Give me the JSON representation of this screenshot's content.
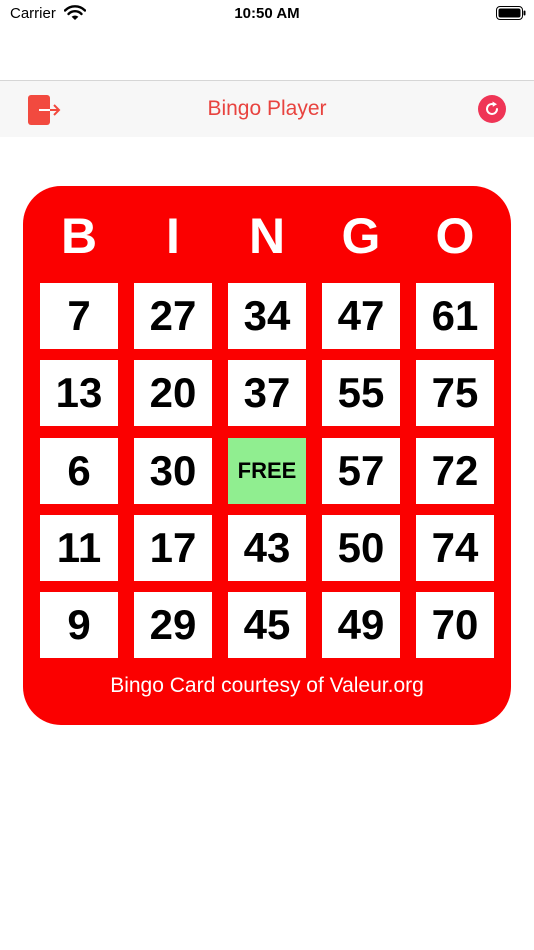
{
  "status_bar": {
    "carrier": "Carrier",
    "time": "10:50 AM",
    "icons": [
      "wifi-icon",
      "battery-icon"
    ]
  },
  "nav": {
    "title": "Bingo Player",
    "left_icon": "exit-icon",
    "right_icon": "refresh-icon",
    "accent_color": "#e8433f"
  },
  "card": {
    "background_color": "#fb0000",
    "free_color": "#90ee90",
    "letters": [
      "B",
      "I",
      "N",
      "G",
      "O"
    ],
    "rows": [
      [
        "7",
        "27",
        "34",
        "47",
        "61"
      ],
      [
        "13",
        "20",
        "37",
        "55",
        "75"
      ],
      [
        "6",
        "30",
        "FREE",
        "57",
        "72"
      ],
      [
        "11",
        "17",
        "43",
        "50",
        "74"
      ],
      [
        "9",
        "29",
        "45",
        "49",
        "70"
      ]
    ],
    "footer": "Bingo Card courtesy of Valeur.org"
  }
}
